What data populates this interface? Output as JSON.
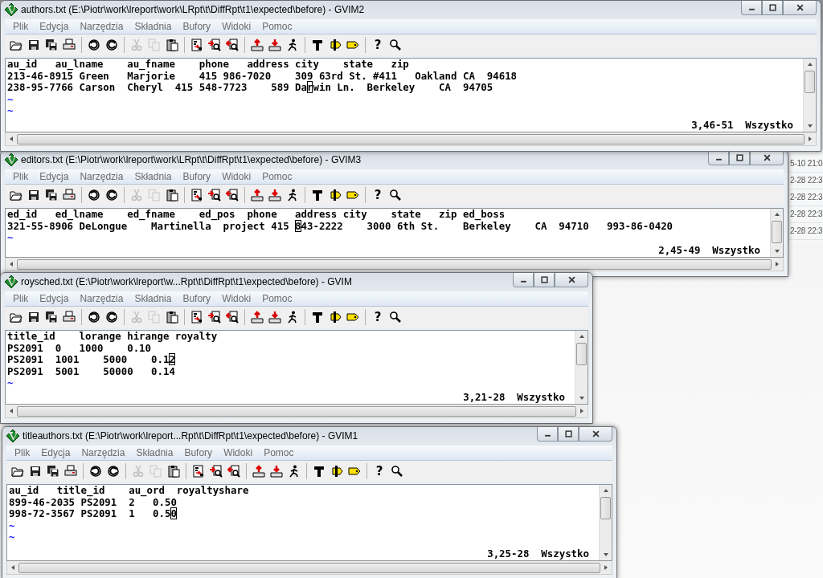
{
  "background_list": [
    {
      "text": "5-10 21:0"
    },
    {
      "text": "2-28 22:3"
    },
    {
      "text": "2-28 22:3"
    },
    {
      "text": "2-28 22:3"
    },
    {
      "text": "2-28 22:3"
    }
  ],
  "windows": [
    {
      "title": "authors.txt (E:\\Piotr\\work\\lreport\\work\\LRpt\\t\\DiffRpt\\t1\\expected\\before) - GVIM2",
      "menu": [
        "Plik",
        "Edycja",
        "Narzędzia",
        "Składnia",
        "Bufory",
        "Widoki",
        "Pomoc"
      ],
      "toolbar_groups": [
        {
          "buttons": [
            {
              "kind": "open",
              "disabled": false
            },
            {
              "kind": "save",
              "disabled": false
            },
            {
              "kind": "save-all",
              "disabled": false
            },
            {
              "kind": "print",
              "disabled": false
            }
          ]
        },
        {
          "buttons": [
            {
              "kind": "undo",
              "disabled": false
            },
            {
              "kind": "redo",
              "disabled": false
            }
          ]
        },
        {
          "buttons": [
            {
              "kind": "cut",
              "disabled": true
            },
            {
              "kind": "copy",
              "disabled": true
            },
            {
              "kind": "paste",
              "disabled": false
            }
          ]
        },
        {
          "buttons": [
            {
              "kind": "replace",
              "disabled": false
            },
            {
              "kind": "find-next",
              "disabled": false
            },
            {
              "kind": "find-previous",
              "disabled": false
            }
          ]
        },
        {
          "buttons": [
            {
              "kind": "load-session",
              "disabled": false
            },
            {
              "kind": "save-session",
              "disabled": false
            },
            {
              "kind": "run-script",
              "disabled": false
            }
          ]
        },
        {
          "buttons": [
            {
              "kind": "make",
              "disabled": false
            },
            {
              "kind": "build-tags",
              "disabled": false
            },
            {
              "kind": "jump-tag",
              "disabled": false
            }
          ]
        },
        {
          "buttons": [
            {
              "kind": "help",
              "glyph": "?",
              "disabled": false
            },
            {
              "kind": "find-help",
              "disabled": false
            }
          ]
        }
      ],
      "lines": [
        {
          "text": "au_id   au_lname    au_fname    phone   address city    state   zip"
        },
        {
          "text": "213-46-8915 Green   Marjorie    415 986-7020    309 63rd St. #411   Oakland CA  94618"
        },
        {
          "before": "238-95-7766 Carson  Cheryl  415 548-7723    589 Da",
          "cursor": "r",
          "after": "win Ln.  Berkeley    CA  94705"
        }
      ],
      "empty_line_marks": [
        "~",
        "~"
      ],
      "status": "3,46-51  Wszystko"
    },
    {
      "title": "editors.txt (E:\\Piotr\\work\\lreport\\work\\LRpt\\t\\DiffRpt\\t1\\expected\\before) - GVIM3",
      "menu": [
        "Plik",
        "Edycja",
        "Narzędzia",
        "Składnia",
        "Bufory",
        "Widoki",
        "Pomoc"
      ],
      "toolbar_groups": [
        {
          "buttons": [
            {
              "kind": "open",
              "disabled": false
            },
            {
              "kind": "save",
              "disabled": false
            },
            {
              "kind": "save-all",
              "disabled": false
            },
            {
              "kind": "print",
              "disabled": false
            }
          ]
        },
        {
          "buttons": [
            {
              "kind": "undo",
              "disabled": false
            },
            {
              "kind": "redo",
              "disabled": false
            }
          ]
        },
        {
          "buttons": [
            {
              "kind": "cut",
              "disabled": true
            },
            {
              "kind": "copy",
              "disabled": true
            },
            {
              "kind": "paste",
              "disabled": false
            }
          ]
        },
        {
          "buttons": [
            {
              "kind": "replace",
              "disabled": false
            },
            {
              "kind": "find-next",
              "disabled": false
            },
            {
              "kind": "find-previous",
              "disabled": false
            }
          ]
        },
        {
          "buttons": [
            {
              "kind": "load-session",
              "disabled": false
            },
            {
              "kind": "save-session",
              "disabled": false
            },
            {
              "kind": "run-script",
              "disabled": false
            }
          ]
        },
        {
          "buttons": [
            {
              "kind": "make",
              "disabled": false
            },
            {
              "kind": "build-tags",
              "disabled": false
            },
            {
              "kind": "jump-tag",
              "disabled": false
            }
          ]
        },
        {
          "buttons": [
            {
              "kind": "help",
              "glyph": "?",
              "disabled": false
            },
            {
              "kind": "find-help",
              "disabled": false
            }
          ]
        }
      ],
      "lines": [
        {
          "text": "ed_id   ed_lname    ed_fname    ed_pos  phone   address city    state   zip ed_boss"
        },
        {
          "before": "321-55-8906 DeLongue    Martinella  project 415 ",
          "cursor": "8",
          "after": "43-2222    3000 6th St.    Berkeley    CA  94710   993-86-0420"
        }
      ],
      "empty_line_marks": [
        "~"
      ],
      "status": "2,45-49  Wszystko"
    },
    {
      "title": "roysched.txt (E:\\Piotr\\work\\lreport\\w...Rpt\\t\\DiffRpt\\t1\\expected\\before) - GVIM",
      "menu": [
        "Plik",
        "Edycja",
        "Narzędzia",
        "Składnia",
        "Bufory",
        "Widoki",
        "Pomoc"
      ],
      "toolbar_groups": [
        {
          "buttons": [
            {
              "kind": "open",
              "disabled": false
            },
            {
              "kind": "save",
              "disabled": false
            },
            {
              "kind": "save-all",
              "disabled": false
            },
            {
              "kind": "print",
              "disabled": false
            }
          ]
        },
        {
          "buttons": [
            {
              "kind": "undo",
              "disabled": false
            },
            {
              "kind": "redo",
              "disabled": false
            }
          ]
        },
        {
          "buttons": [
            {
              "kind": "cut",
              "disabled": true
            },
            {
              "kind": "copy",
              "disabled": true
            },
            {
              "kind": "paste",
              "disabled": false
            }
          ]
        },
        {
          "buttons": [
            {
              "kind": "replace",
              "disabled": false
            },
            {
              "kind": "find-next",
              "disabled": false
            },
            {
              "kind": "find-previous",
              "disabled": false
            }
          ]
        },
        {
          "buttons": [
            {
              "kind": "load-session",
              "disabled": false
            },
            {
              "kind": "save-session",
              "disabled": false
            },
            {
              "kind": "run-script",
              "disabled": false
            }
          ]
        },
        {
          "buttons": [
            {
              "kind": "make",
              "disabled": false
            },
            {
              "kind": "build-tags",
              "disabled": false
            },
            {
              "kind": "jump-tag",
              "disabled": false
            }
          ]
        },
        {
          "buttons": [
            {
              "kind": "help",
              "glyph": "?",
              "disabled": false
            },
            {
              "kind": "find-help",
              "disabled": false
            }
          ]
        }
      ],
      "lines": [
        {
          "text": "title_id    lorange hirange royalty"
        },
        {
          "text": "PS2091  0   1000    0.10"
        },
        {
          "before": "PS2091  1001    5000    0.1",
          "cursor": "2"
        },
        {
          "text": "PS2091  5001    50000   0.14"
        }
      ],
      "empty_line_marks": [
        "~"
      ],
      "status": "3,21-28  Wszystko"
    },
    {
      "title": "titleauthors.txt (E:\\Piotr\\work\\lreport...Rpt\\t\\DiffRpt\\t1\\expected\\before) - GVIM1",
      "menu": [
        "Plik",
        "Edycja",
        "Narzędzia",
        "Składnia",
        "Bufory",
        "Widoki",
        "Pomoc"
      ],
      "toolbar_groups": [
        {
          "buttons": [
            {
              "kind": "open",
              "disabled": false
            },
            {
              "kind": "save",
              "disabled": false
            },
            {
              "kind": "save-all",
              "disabled": false
            },
            {
              "kind": "print",
              "disabled": false
            }
          ]
        },
        {
          "buttons": [
            {
              "kind": "undo",
              "disabled": false
            },
            {
              "kind": "redo",
              "disabled": false
            }
          ]
        },
        {
          "buttons": [
            {
              "kind": "cut",
              "disabled": true
            },
            {
              "kind": "copy",
              "disabled": true
            },
            {
              "kind": "paste",
              "disabled": false
            }
          ]
        },
        {
          "buttons": [
            {
              "kind": "replace",
              "disabled": false
            },
            {
              "kind": "find-next",
              "disabled": false
            },
            {
              "kind": "find-previous",
              "disabled": false
            }
          ]
        },
        {
          "buttons": [
            {
              "kind": "load-session",
              "disabled": false
            },
            {
              "kind": "save-session",
              "disabled": false
            },
            {
              "kind": "run-script",
              "disabled": false
            }
          ]
        },
        {
          "buttons": [
            {
              "kind": "make",
              "disabled": false
            },
            {
              "kind": "build-tags",
              "disabled": false
            },
            {
              "kind": "jump-tag",
              "disabled": false
            }
          ]
        },
        {
          "buttons": [
            {
              "kind": "help",
              "glyph": "?",
              "disabled": false
            },
            {
              "kind": "find-help",
              "disabled": false
            }
          ]
        }
      ],
      "lines": [
        {
          "text": "au_id   title_id    au_ord  royaltyshare"
        },
        {
          "text": "899-46-2035 PS2091  2   0.50"
        },
        {
          "before": "998-72-3567 PS2091  1   0.5",
          "cursor": "0"
        }
      ],
      "empty_line_marks": [
        "~",
        "~"
      ],
      "status": "3,25-28  Wszystko"
    }
  ]
}
